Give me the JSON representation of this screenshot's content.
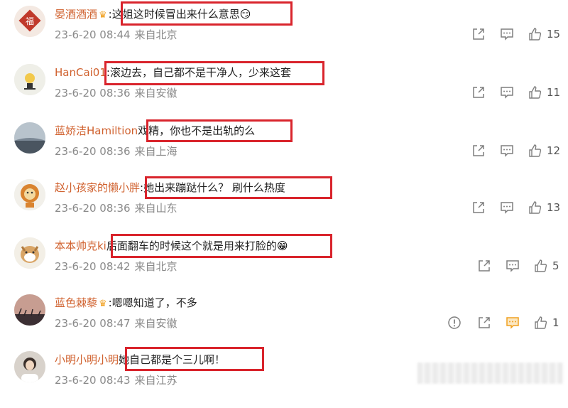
{
  "comments": [
    {
      "username": "晏酒酒酒",
      "vip": true,
      "text": ":这姐这时候冒出来什么意思",
      "emoji": "😏",
      "time": "23-6-20 08:44",
      "location": "来自北京",
      "likes": "15"
    },
    {
      "username": "HanCai01",
      "vip": false,
      "text": ":滚边去，自己都不是干净人，少来这套",
      "emoji": "",
      "time": "23-6-20 08:36",
      "location": "来自安徽",
      "likes": "11"
    },
    {
      "username": "蓝娇洁Hamiltion",
      "vip": false,
      "text": "戏精，你也不是出轨的么",
      "emoji": "",
      "time": "23-6-20 08:36",
      "location": "来自上海",
      "likes": "12"
    },
    {
      "username": "赵小孩家的懒小胖",
      "vip": false,
      "text": ":她出来蹦跶什么？ 刷什么热度",
      "emoji": "",
      "time": "23-6-20 08:36",
      "location": "来自山东",
      "likes": "13"
    },
    {
      "username": "本本帅克ki",
      "vip": false,
      "text": "后面翻车的时候这个就是用来打脸的",
      "emoji": "😁",
      "time": "23-6-20 08:42",
      "location": "来自北京",
      "likes": "5"
    },
    {
      "username": "蓝色棘藜",
      "vip": true,
      "text": ":嗯嗯知道了，不多",
      "emoji": "",
      "time": "23-6-20 08:47",
      "location": "来自安徽",
      "likes": "1"
    },
    {
      "username": "小明小明小明",
      "vip": false,
      "text": "她自己都是个三儿啊！",
      "emoji": "",
      "time": "23-6-20 08:43",
      "location": "来自江苏",
      "likes": ""
    }
  ],
  "icons": {
    "share": "share-icon",
    "comment": "comment-icon",
    "like": "thumbs-up-icon",
    "report": "report-icon"
  },
  "colors": {
    "username": "#d0612e",
    "highlight_box": "#d9242c",
    "meta_text": "#8a8a8a",
    "active_comment_icon": "#f0a020"
  }
}
